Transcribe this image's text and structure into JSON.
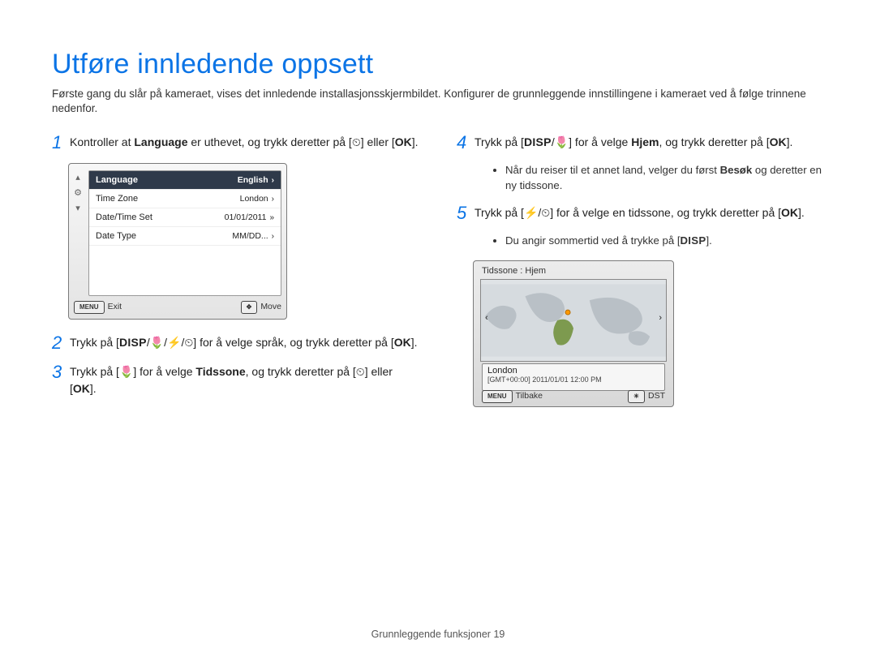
{
  "title": "Utføre innledende oppsett",
  "lead": "Første gang du slår på kameraet, vises det innledende installasjonsskjermbildet. Konfigurer de grunnleggende innstillingene i kameraet ved å følge trinnene nedenfor.",
  "icons": {
    "disp": "DISP",
    "macro": "🌷",
    "flash": "⚡",
    "timer": "⏲",
    "ok": "OK",
    "menu": "MENU",
    "nav": "✥",
    "dst": "☀"
  },
  "steps": {
    "s1_a": "Kontroller at ",
    "s1_lang": "Language",
    "s1_b": " er uthevet, og trykk deretter på [",
    "s1_c": "] eller [",
    "s1_d": "].",
    "s2_a": "Trykk på [",
    "s2_b": "] for å velge språk, og trykk deretter på [",
    "s2_c": "].",
    "s3_a": "Trykk på [",
    "s3_b": "] for å velge ",
    "s3_tz": "Tidssone",
    "s3_c": ", og trykk deretter på [",
    "s3_d": "] eller [",
    "s3_e": "].",
    "s4_a": "Trykk på [",
    "s4_b": "] for å velge ",
    "s4_hjem": "Hjem",
    "s4_c": ", og trykk deretter på [",
    "s4_d": "].",
    "s4_bullet_a": "Når du reiser til et annet land, velger du først ",
    "s4_bullet_besok": "Besøk",
    "s4_bullet_b": " og deretter en ny tidssone.",
    "s5_a": "Trykk på [",
    "s5_b": "] for å velge en tidssone, og trykk deretter på [",
    "s5_c": "].",
    "s5_bullet": "Du angir sommertid ved å trykke på ["
  },
  "lcd": {
    "rows": [
      {
        "label": "Language",
        "value": "English"
      },
      {
        "label": "Time Zone",
        "value": "London"
      },
      {
        "label": "Date/Time Set",
        "value": "01/01/2011"
      },
      {
        "label": "Date Type",
        "value": "MM/DD..."
      }
    ],
    "exit": "Exit",
    "move": "Move"
  },
  "tz": {
    "title": "Tidssone : Hjem",
    "city": "London",
    "stamp": "[GMT+00:00]  2011/01/01  12:00 PM",
    "back": "Tilbake",
    "dst": "DST"
  },
  "footer": "Grunnleggende funksjoner  19"
}
